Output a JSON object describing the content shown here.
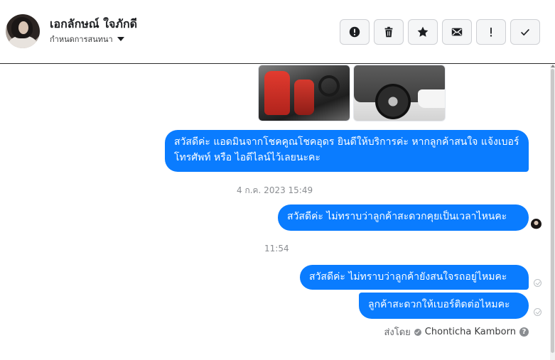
{
  "header": {
    "name": "เอกลักษณ์ ใจภักดี",
    "assign_label": "กำหนดการสนทนา",
    "actions": [
      {
        "icon": "alert-circle-icon",
        "glyph": "!"
      },
      {
        "icon": "trash-icon"
      },
      {
        "icon": "star-icon"
      },
      {
        "icon": "envelope-icon"
      },
      {
        "icon": "exclamation-icon",
        "glyph": "!"
      },
      {
        "icon": "checkmark-icon"
      }
    ]
  },
  "messages": [
    {
      "text": "สวัสดีค่ะ แอดมินจากโชคคูณโชคอุดร ยินดีให้บริการค่ะ หากลูกค้าสนใจ แจ้งเบอร์โทรศัพท์ หรือ ไอดีไลน์ไว้เลยนะคะ"
    },
    {
      "text": "สวัสดีค่ะ ไม่ทราบว่าลูกค้าสะดวกคุยเป็นเวลาไหนคะ"
    },
    {
      "text": "สวัสดีค่ะ ไม่ทราบว่าลูกค้ายังสนใจรถอยู่ไหมคะ"
    },
    {
      "text": "ลูกค้าสะดวกให้เบอร์ติดต่อไหมคะ"
    }
  ],
  "timestamps": {
    "first": "4 ก.ค. 2023 15:49",
    "second": "11:54"
  },
  "sent_by": {
    "label": "ส่งโดย",
    "name": "Chonticha Kamborn",
    "help": "?"
  },
  "colors": {
    "bubble": "#0a7cff",
    "timestamp": "#8a8d91"
  }
}
